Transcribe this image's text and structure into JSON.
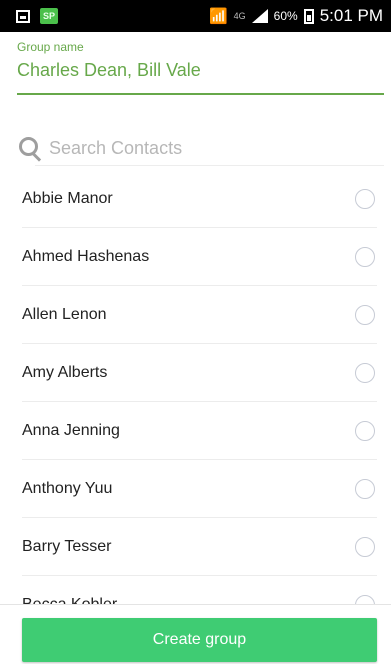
{
  "status_bar": {
    "battery_percent": "60%",
    "time": "5:01 PM",
    "network_type": "4G",
    "app_icon_text": "SP",
    "icons": [
      "gallery-icon",
      "app-notification-icon",
      "wifi-icon",
      "cell-signal-icon",
      "battery-icon"
    ]
  },
  "form": {
    "group_label": "Group name",
    "group_value": "Charles Dean, Bill Vale",
    "search_placeholder": "Search Contacts"
  },
  "contacts": [
    {
      "name": "Abbie Manor",
      "selected": false
    },
    {
      "name": "Ahmed Hashenas",
      "selected": false
    },
    {
      "name": "Allen Lenon",
      "selected": false
    },
    {
      "name": "Amy Alberts",
      "selected": false
    },
    {
      "name": "Anna Jenning",
      "selected": false
    },
    {
      "name": "Anthony Yuu",
      "selected": false
    },
    {
      "name": "Barry Tesser",
      "selected": false
    },
    {
      "name": "Becca Kobler",
      "selected": false
    }
  ],
  "actions": {
    "create_label": "Create group"
  },
  "colors": {
    "accent_green": "#67a84a",
    "button_green": "#3fcc73",
    "radio_border": "#c7cbd5"
  }
}
